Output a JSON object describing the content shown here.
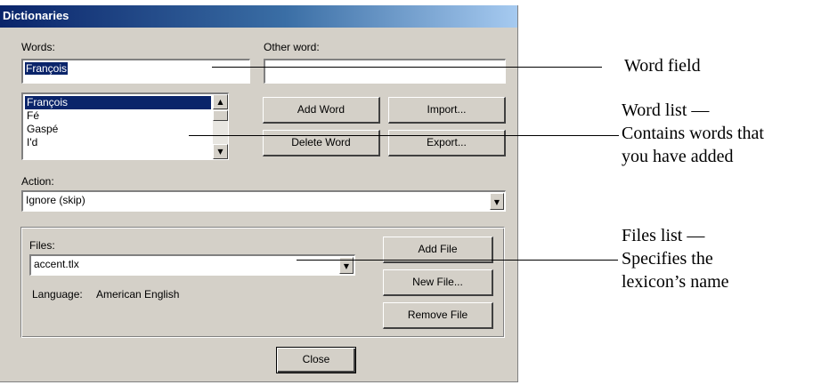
{
  "dialog": {
    "title": "Dictionaries",
    "words_label": "Words:",
    "words_value": "François",
    "other_word_label": "Other word:",
    "other_word_value": "",
    "word_list": [
      "François",
      "Fé",
      "Gaspé",
      "I'd"
    ],
    "add_word_label": "Add Word",
    "import_label": "Import...",
    "delete_word_label": "Delete Word",
    "export_label": "Export...",
    "action_label": "Action:",
    "action_value": "Ignore (skip)",
    "files_label": "Files:",
    "files_value": "accent.tlx",
    "language_label": "Language:",
    "language_value": "American English",
    "add_file_label": "Add File",
    "new_file_label": "New File...",
    "remove_file_label": "Remove File",
    "close_label": "Close"
  },
  "callouts": {
    "word_field": [
      "Word field"
    ],
    "word_list": [
      "Word list —",
      "Contains words that",
      "you have added"
    ],
    "files_list": [
      "Files list —",
      "Specifies the",
      "lexicon’s name"
    ]
  },
  "icons": {
    "scroll_up": "▲",
    "scroll_down": "▼",
    "dropdown": "▼"
  }
}
